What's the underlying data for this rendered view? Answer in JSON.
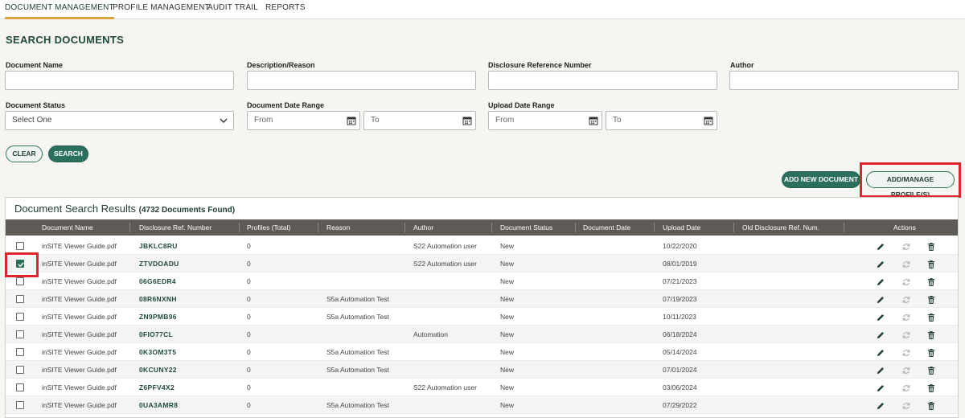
{
  "nav": {
    "tabs": [
      {
        "label": "DOCUMENT MANAGEMENT",
        "active": true
      },
      {
        "label": "PROFILE MANAGEMENT",
        "active": false
      },
      {
        "label": "AUDIT TRAIL",
        "active": false
      },
      {
        "label": "REPORTS",
        "active": false
      }
    ]
  },
  "search": {
    "title": "SEARCH DOCUMENTS",
    "fields": {
      "document_name": {
        "label": "Document Name",
        "value": ""
      },
      "description": {
        "label": "Description/Reason",
        "value": ""
      },
      "disclosure_ref": {
        "label": "Disclosure Reference Number",
        "value": ""
      },
      "author": {
        "label": "Author",
        "value": ""
      },
      "status": {
        "label": "Document Status",
        "value": "Select One"
      },
      "doc_date": {
        "label": "Document Date Range",
        "from": "From",
        "to": "To"
      },
      "upload_date": {
        "label": "Upload Date Range",
        "from": "From",
        "to": "To"
      }
    },
    "clear_label": "CLEAR",
    "search_label": "SEARCH"
  },
  "actions": {
    "add_new_document": "ADD NEW DOCUMENT",
    "add_manage_profiles": "ADD/MANAGE PROFILE(S)"
  },
  "results": {
    "title": "Document Search Results",
    "count_text": "(4732 Documents Found)",
    "columns": [
      "Document Name",
      "Disclosure Ref. Number",
      "Profiles (Total)",
      "Reason",
      "Author",
      "Document Status",
      "Document Date",
      "Upload Date",
      "Old Disclosure Ref. Num.",
      "Actions"
    ],
    "rows": [
      {
        "checked": false,
        "name": "inSITE Viewer Guide.pdf",
        "ref": "JBKLC8RU",
        "profiles": "0",
        "reason": "",
        "author": "S22 Automation user",
        "status": "New",
        "doc_date": "",
        "upload_date": "10/22/2020",
        "old_ref": ""
      },
      {
        "checked": true,
        "name": "inSITE Viewer Guide.pdf",
        "ref": "ZTVDOADU",
        "profiles": "0",
        "reason": "",
        "author": "S22 Automation user",
        "status": "New",
        "doc_date": "",
        "upload_date": "08/01/2019",
        "old_ref": ""
      },
      {
        "checked": false,
        "name": "inSITE Viewer Guide.pdf",
        "ref": "06G6EDR4",
        "profiles": "0",
        "reason": "",
        "author": "",
        "status": "New",
        "doc_date": "",
        "upload_date": "07/21/2023",
        "old_ref": ""
      },
      {
        "checked": false,
        "name": "inSITE Viewer Guide.pdf",
        "ref": "08R6NXNH",
        "profiles": "0",
        "reason": "S5a Automation Test",
        "author": "",
        "status": "New",
        "doc_date": "",
        "upload_date": "07/19/2023",
        "old_ref": ""
      },
      {
        "checked": false,
        "name": "inSITE Viewer Guide.pdf",
        "ref": "ZN9PMB96",
        "profiles": "0",
        "reason": "S5a Automation Test",
        "author": "",
        "status": "New",
        "doc_date": "",
        "upload_date": "10/11/2023",
        "old_ref": ""
      },
      {
        "checked": false,
        "name": "inSITE Viewer Guide.pdf",
        "ref": "0FIO77CL",
        "profiles": "0",
        "reason": "",
        "author": "Automation",
        "status": "New",
        "doc_date": "",
        "upload_date": "06/18/2024",
        "old_ref": ""
      },
      {
        "checked": false,
        "name": "inSITE Viewer Guide.pdf",
        "ref": "0K3OM3T5",
        "profiles": "0",
        "reason": "S5a Automation Test",
        "author": "",
        "status": "New",
        "doc_date": "",
        "upload_date": "05/14/2024",
        "old_ref": ""
      },
      {
        "checked": false,
        "name": "inSITE Viewer Guide.pdf",
        "ref": "0KCUNY22",
        "profiles": "0",
        "reason": "S5a Automation Test",
        "author": "",
        "status": "New",
        "doc_date": "",
        "upload_date": "07/01/2024",
        "old_ref": ""
      },
      {
        "checked": false,
        "name": "inSITE Viewer Guide.pdf",
        "ref": "Z6PFV4X2",
        "profiles": "0",
        "reason": "",
        "author": "S22 Automation user",
        "status": "New",
        "doc_date": "",
        "upload_date": "03/06/2024",
        "old_ref": ""
      },
      {
        "checked": false,
        "name": "inSITE Viewer Guide.pdf",
        "ref": "0UA3AMR8",
        "profiles": "0",
        "reason": "S5a Automation Test",
        "author": "",
        "status": "New",
        "doc_date": "",
        "upload_date": "07/29/2022",
        "old_ref": ""
      }
    ]
  },
  "icons": {
    "edit": "pencil-icon",
    "refresh": "refresh-icon",
    "delete": "trash-icon",
    "calendar": "calendar-icon",
    "chevron": "chevron-down-icon"
  },
  "colors": {
    "accent": "#2b705c",
    "highlight": "#e0242c",
    "tab_underline": "#d9a441"
  }
}
